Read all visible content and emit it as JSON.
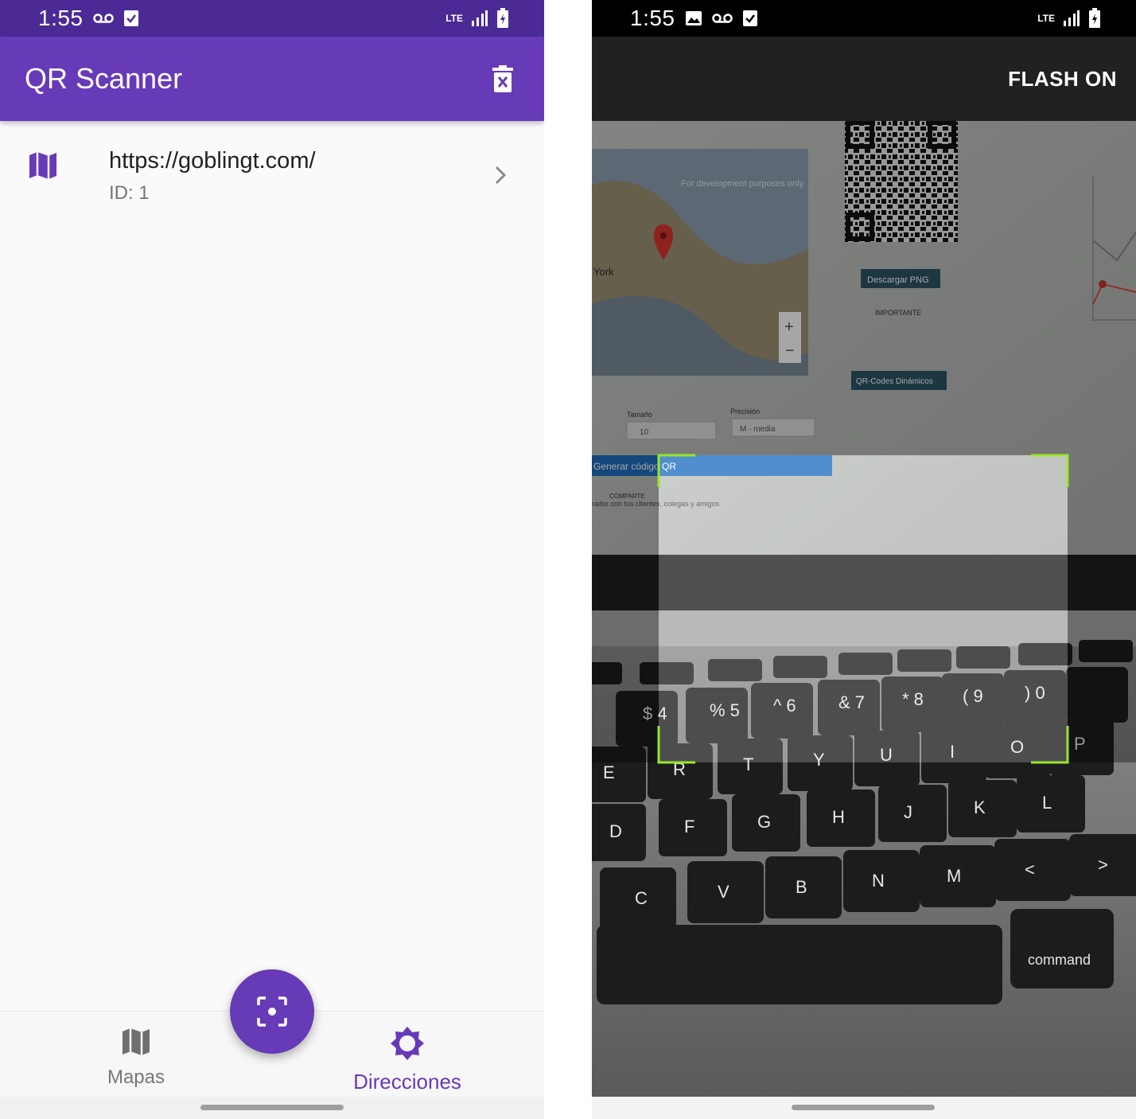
{
  "left": {
    "status": {
      "time": "1:55",
      "network": "LTE"
    },
    "app_bar": {
      "title": "QR Scanner"
    },
    "list": [
      {
        "title": "https://goblingt.com/",
        "subtitle": "ID: 1",
        "icon": "map-icon"
      }
    ],
    "bottom_nav": {
      "items": [
        {
          "label": "Mapas",
          "icon": "map-icon",
          "active": false
        },
        {
          "label": "Direcciones",
          "icon": "brightness-icon",
          "active": true
        }
      ]
    },
    "fab": {
      "icon": "center-focus-icon"
    }
  },
  "right": {
    "status": {
      "time": "1:55",
      "network": "LTE"
    },
    "flash_button": "FLASH ON",
    "camera": {
      "keyboard_rows": [
        [
          "$ 4",
          "% 5",
          "^ 6",
          "& 7",
          "* 8",
          "( 9",
          ") 0"
        ],
        [
          "E",
          "R",
          "T",
          "Y",
          "U",
          "I",
          "O",
          "P"
        ],
        [
          "D",
          "F",
          "G",
          "H",
          "J",
          "K",
          "L"
        ],
        [
          "C",
          "V",
          "B",
          "N",
          "M",
          "<",
          ">"
        ]
      ],
      "command_key": "command",
      "screen_texts": {
        "city": "York",
        "download": "Descargar PNG",
        "important": "IMPORTANTE",
        "generate": "Generar código QR",
        "share": "COMPARTE",
        "share_text": "rador con tus clientes, colegas y amigos",
        "size_label": "Tamaño",
        "size_value": "10",
        "precision_label": "Precisión",
        "precision_value": "M - media",
        "dynamic": "QR-Codes Dinámicos",
        "dev": "For development purposes only"
      }
    }
  },
  "colors": {
    "primary": "#673ab7",
    "status_bar": "#4b2a96",
    "scanner_corner": "#9ae62c"
  }
}
